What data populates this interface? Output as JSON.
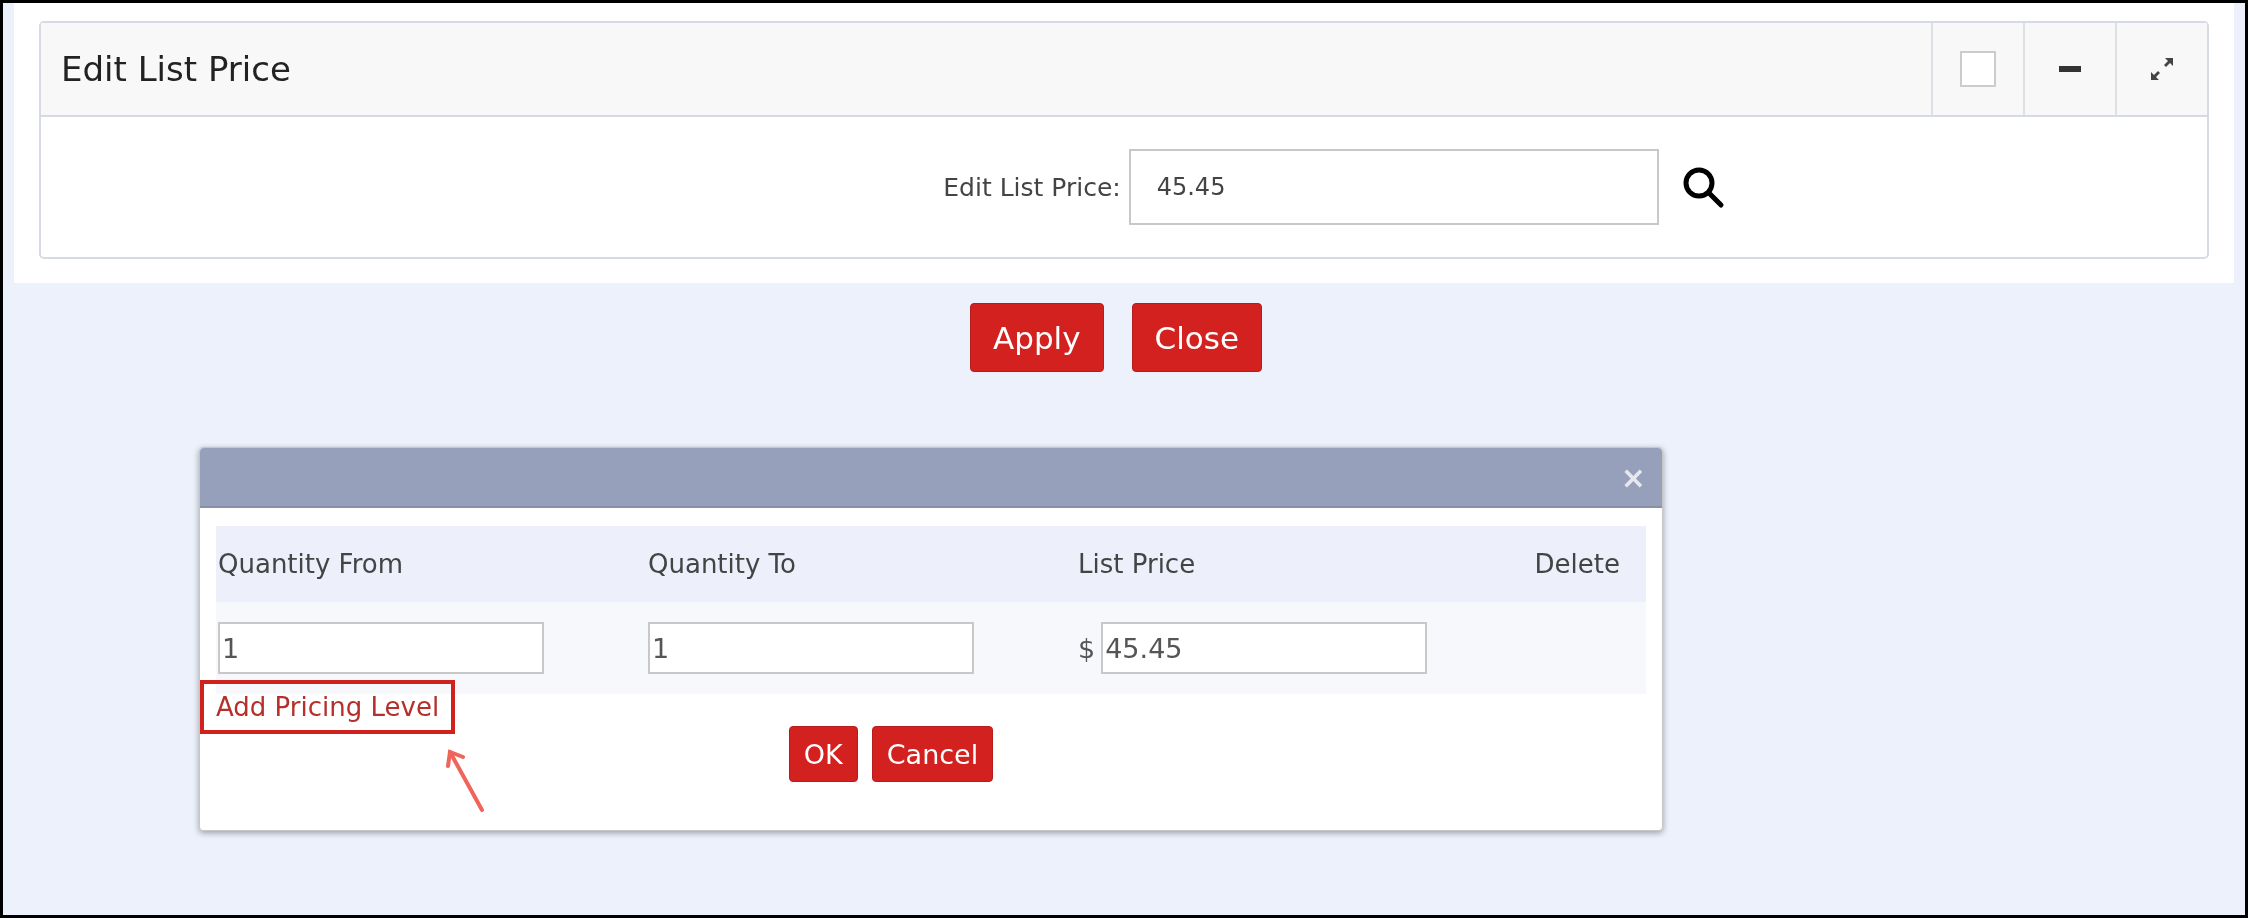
{
  "panel": {
    "title": "Edit List Price",
    "checked": false,
    "field": {
      "label": "Edit List Price:",
      "value": "45.45"
    }
  },
  "buttons": [
    "Apply",
    "Close"
  ],
  "dialog": {
    "close": "×",
    "columns": [
      "Quantity From",
      "Quantity To",
      "List Price",
      "Delete"
    ],
    "rows": [
      {
        "from": "1",
        "to": "1",
        "currency": "$",
        "price": "45.45"
      }
    ],
    "link": "Add Pricing Level",
    "buttons": [
      "OK",
      "Cancel"
    ]
  }
}
